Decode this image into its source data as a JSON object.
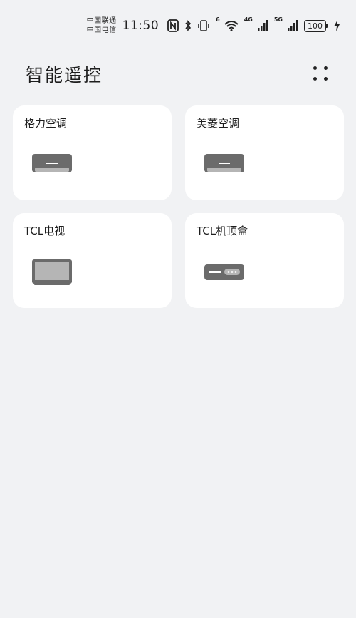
{
  "status_bar": {
    "carriers": [
      "中国联通",
      "中国电信"
    ],
    "time": "11:50",
    "wifi_label": "6",
    "network_1": "4G",
    "network_2": "5G",
    "battery": "100"
  },
  "header": {
    "title": "智能遥控",
    "menu_icon": "grid-dots-icon"
  },
  "devices": [
    {
      "name": "格力空调",
      "icon": "air-conditioner-icon"
    },
    {
      "name": "美菱空调",
      "icon": "air-conditioner-icon"
    },
    {
      "name": "TCL电视",
      "icon": "tv-icon"
    },
    {
      "name": "TCL机顶盒",
      "icon": "set-top-box-icon"
    }
  ],
  "colors": {
    "background": "#f1f2f4",
    "card": "#ffffff",
    "icon_dark": "#6b6b6b",
    "icon_light": "#b5b5b5"
  }
}
